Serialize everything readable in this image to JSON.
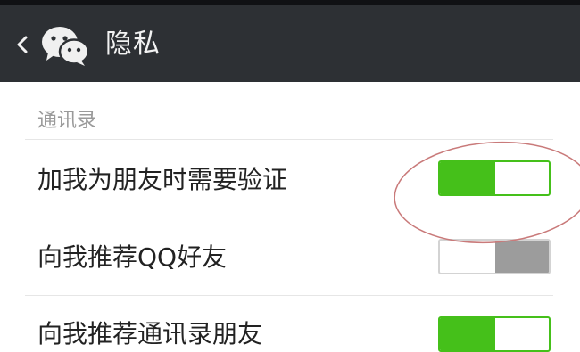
{
  "header": {
    "back_icon": "chevron-left-icon",
    "logo_icon": "wechat-logo-icon",
    "title": "隐私"
  },
  "section": {
    "label": "通讯录"
  },
  "settings": [
    {
      "label": "加我为朋友时需要验证",
      "enabled": true
    },
    {
      "label": "向我推荐QQ好友",
      "enabled": false
    },
    {
      "label": "向我推荐通讯录朋友",
      "enabled": true
    }
  ],
  "colors": {
    "header_bg": "#2d3034",
    "switch_on": "#45c01a",
    "switch_off": "#9c9c9c",
    "annotation_circle": "#c97a7a"
  }
}
